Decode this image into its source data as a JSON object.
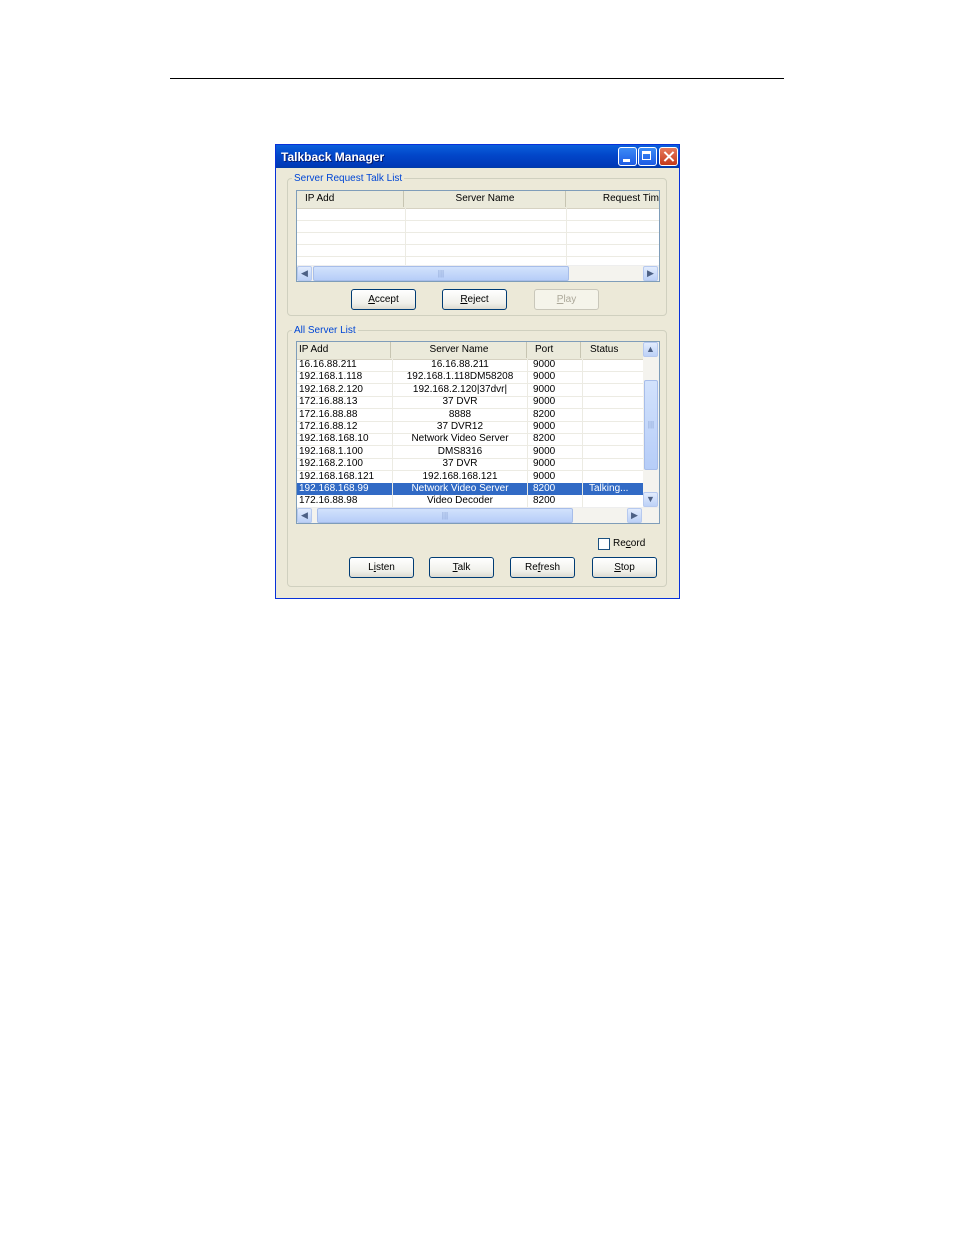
{
  "window": {
    "title": "Talkback Manager"
  },
  "request_group": {
    "legend": "Server Request Talk List",
    "columns": [
      "IP Add",
      "Server Name",
      "Request Tim"
    ],
    "buttons": {
      "accept": {
        "pre": "",
        "key": "A",
        "post": "ccept"
      },
      "reject": {
        "pre": "",
        "key": "R",
        "post": "eject"
      },
      "play": {
        "pre": "",
        "key": "P",
        "post": "lay"
      }
    }
  },
  "server_group": {
    "legend": "All Server List",
    "columns": [
      "IP Add",
      "Server Name",
      "Port",
      "Status"
    ],
    "rows": [
      {
        "ip": "16.16.88.211",
        "name": "16.16.88.211",
        "port": "9000",
        "status": ""
      },
      {
        "ip": "192.168.1.118",
        "name": "192.168.1.118DM58208",
        "port": "9000",
        "status": ""
      },
      {
        "ip": "192.168.2.120",
        "name": "192.168.2.120|37dvr|",
        "port": "9000",
        "status": ""
      },
      {
        "ip": "172.16.88.13",
        "name": "37 DVR",
        "port": "9000",
        "status": ""
      },
      {
        "ip": "172.16.88.88",
        "name": "8888",
        "port": "8200",
        "status": ""
      },
      {
        "ip": "172.16.88.12",
        "name": "37 DVR12",
        "port": "9000",
        "status": ""
      },
      {
        "ip": "192.168.168.10",
        "name": "Network Video Server",
        "port": "8200",
        "status": ""
      },
      {
        "ip": "192.168.1.100",
        "name": "DMS8316",
        "port": "9000",
        "status": ""
      },
      {
        "ip": "192.168.2.100",
        "name": "37 DVR",
        "port": "9000",
        "status": ""
      },
      {
        "ip": "192.168.168.121",
        "name": "192.168.168.121",
        "port": "9000",
        "status": ""
      },
      {
        "ip": "192.168.168.99",
        "name": "Network Video Server",
        "port": "8200",
        "status": "Talking..."
      },
      {
        "ip": "172.16.88.98",
        "name": "Video Decoder",
        "port": "8200",
        "status": ""
      }
    ],
    "selected_row": 10,
    "record": {
      "pre": "Re",
      "key": "c",
      "post": "ord",
      "checked": false
    },
    "buttons": {
      "listen": {
        "pre": "L",
        "key": "i",
        "post": "sten"
      },
      "talk": {
        "pre": "",
        "key": "T",
        "post": "alk"
      },
      "refresh": {
        "pre": "Re",
        "key": "f",
        "post": "resh"
      },
      "stop": {
        "pre": "",
        "key": "S",
        "post": "top"
      }
    }
  },
  "icons": {
    "scroll_left": "◀",
    "scroll_right": "▶",
    "scroll_up": "▲",
    "scroll_down": "▼",
    "grip": "|||"
  }
}
